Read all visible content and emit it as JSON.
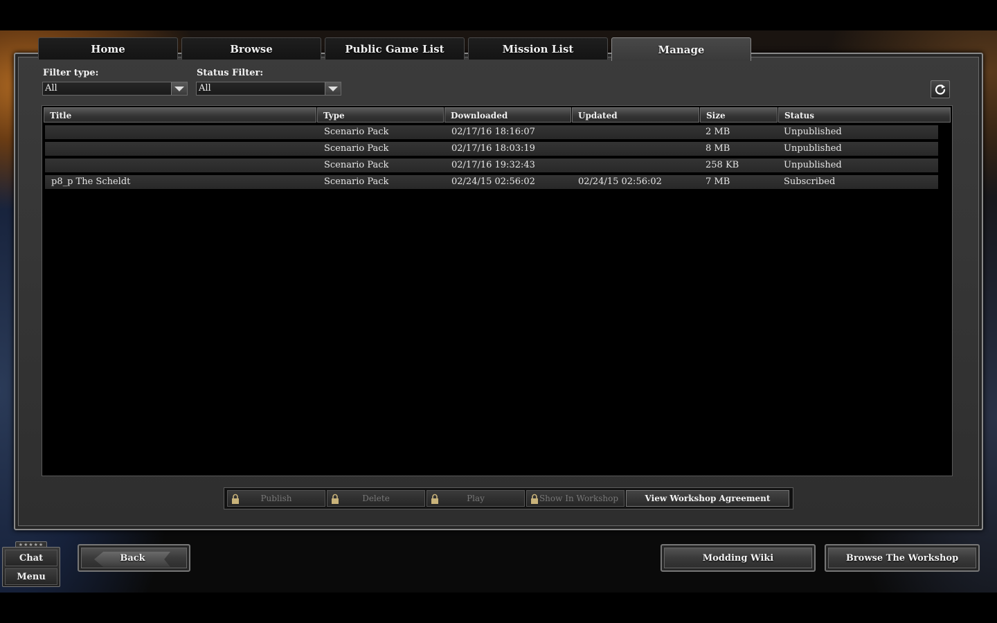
{
  "tabs": [
    {
      "label": "Home"
    },
    {
      "label": "Browse"
    },
    {
      "label": "Public Game List"
    },
    {
      "label": "Mission List"
    },
    {
      "label": "Manage",
      "active": true
    }
  ],
  "filters": {
    "filter_type_label": "Filter type:",
    "filter_type_value": "All",
    "status_filter_label": "Status Filter:",
    "status_filter_value": "All"
  },
  "table": {
    "columns": [
      "Title",
      "Type",
      "Downloaded",
      "Updated",
      "Size",
      "Status"
    ],
    "rows": [
      {
        "title": "",
        "type": "Scenario Pack",
        "downloaded": "02/17/16 18:16:07",
        "updated": "",
        "size": "2 MB",
        "status": "Unpublished"
      },
      {
        "title": "",
        "type": "Scenario Pack",
        "downloaded": "02/17/16 18:03:19",
        "updated": "",
        "size": "8 MB",
        "status": "Unpublished"
      },
      {
        "title": "",
        "type": "Scenario Pack",
        "downloaded": "02/17/16 19:32:43",
        "updated": "",
        "size": "258 KB",
        "status": "Unpublished"
      },
      {
        "title": "p8_p The Scheldt",
        "type": "Scenario Pack",
        "downloaded": "02/24/15 02:56:02",
        "updated": "02/24/15 02:56:02",
        "size": "7 MB",
        "status": "Subscribed"
      }
    ]
  },
  "actions": {
    "publish": "Publish",
    "delete": "Delete",
    "play": "Play",
    "show_in_workshop": "Show In Workshop",
    "view_agreement": "View Workshop Agreement"
  },
  "bottom": {
    "chat": "Chat",
    "menu": "Menu",
    "stars": "★★★★★",
    "back": "Back",
    "modding_wiki": "Modding Wiki",
    "browse_workshop": "Browse The Workshop"
  },
  "icons": {
    "refresh": "refresh-icon",
    "lock": "lock-icon",
    "dropdown": "chevron-down-icon"
  }
}
